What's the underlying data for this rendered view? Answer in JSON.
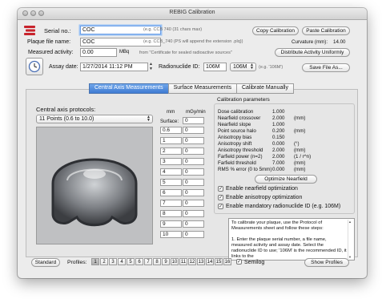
{
  "window": {
    "title": "REBIG Calibration"
  },
  "header": {
    "serial_label": "Serial no.:",
    "serial_value": "COC",
    "serial_hint": "(e.g. CCB 740 (31 chars max)",
    "copy_button": "Copy Calibration",
    "paste_button": "Paste Calibration",
    "plaque_label": "Plaque file name:",
    "plaque_value": "COC",
    "plaque_hint": "(e.g. CCB_740 (PS will append the extension .plq))",
    "curvature_label": "Curvature (mm):",
    "curvature_value": "14.00",
    "activity_label": "Measured activity:",
    "activity_value": "0.00",
    "activity_unit": "MBq",
    "activity_hint": "from \"Certificate for sealed radioactive sources\"",
    "distribute_button": "Distribute Activity Uniformly",
    "assay_label": "Assay date:",
    "assay_value": "1/27/2014 11:12 PM",
    "radionuclide_label": "Radionuclide ID:",
    "radionuclide_value": "106M",
    "radionuclide_select": "106M",
    "radionuclide_hint": "(e.g. '106M')",
    "save_button": "Save File As..."
  },
  "tabs": [
    {
      "label": "Central Axis Measurements",
      "selected": true
    },
    {
      "label": "Surface Measurements",
      "selected": false
    },
    {
      "label": "Calibrate Manually",
      "selected": false
    }
  ],
  "protocols": {
    "label": "Central axis protocols:",
    "selected": "11 Points (0.6 to 10.0)"
  },
  "measurements": {
    "col_mm": "mm",
    "col_rate": "mGy/min",
    "surface_label": "Surface:",
    "rows": [
      {
        "mm": "",
        "rate": "0"
      },
      {
        "mm": "0.6",
        "rate": "0"
      },
      {
        "mm": "1",
        "rate": "0"
      },
      {
        "mm": "2",
        "rate": "0"
      },
      {
        "mm": "3",
        "rate": "0"
      },
      {
        "mm": "4",
        "rate": "0"
      },
      {
        "mm": "5",
        "rate": "0"
      },
      {
        "mm": "6",
        "rate": "0"
      },
      {
        "mm": "7",
        "rate": "0"
      },
      {
        "mm": "8",
        "rate": "0"
      },
      {
        "mm": "9",
        "rate": "0"
      },
      {
        "mm": "10",
        "rate": "0"
      }
    ]
  },
  "calibration": {
    "title": "Calibration parameters",
    "params": [
      {
        "name": "Dose calibration",
        "value": "1.000",
        "unit": ""
      },
      {
        "name": "Nearfield crossover",
        "value": "2.000",
        "unit": "(mm)"
      },
      {
        "name": "Nearfield slope",
        "value": "1.000",
        "unit": ""
      },
      {
        "name": "Point source halo",
        "value": "0.200",
        "unit": "(mm)"
      },
      {
        "name": "Anisotropy bias",
        "value": "0.150",
        "unit": ""
      },
      {
        "name": "Anisotropy shift",
        "value": "0.000",
        "unit": "(°)"
      },
      {
        "name": "Anisotropy threshold",
        "value": "2.000",
        "unit": "(mm)"
      },
      {
        "name": "Farfield power (n=2)",
        "value": "2.000",
        "unit": "(1 / r^n)"
      },
      {
        "name": "Farfield threshold",
        "value": "7.000",
        "unit": "(mm)"
      },
      {
        "name": "RMS % error (0 to 5mm)",
        "value": "0.000",
        "unit": "(mm)"
      }
    ],
    "optimize_button": "Optimize Nearfield",
    "checkboxes": [
      {
        "label": "Enable nearfield optimization",
        "checked": true
      },
      {
        "label": "Enable anisotropy optimization",
        "checked": true
      },
      {
        "label": "Enable mandatory radionuclide ID (e.g. 106M)",
        "checked": true
      }
    ],
    "instructions": "To calibrate your plaque, use the Protocol of Measurements sheet and follow these steps:\n\n1. Enter the plaque serial number, a file name, measured activity and assay date. Select the radionuclide ID to use; '106M' is the recommended ID, it links to the"
  },
  "footer": {
    "standard_button": "Standard",
    "profiles_label": "Profiles:",
    "profiles": [
      "1",
      "2",
      "3",
      "4",
      "5",
      "6",
      "7",
      "8",
      "9",
      "10",
      "11",
      "12",
      "13",
      "14",
      "15",
      "16"
    ],
    "semilog_label": "Semilog",
    "semilog_checked": true,
    "show_profiles_button": "Show Profiles"
  },
  "colors": {
    "accent": "#3f7bd3",
    "window_bg": "#ececec",
    "logo_red": "#c8232c"
  },
  "icons": {
    "logo": "plaque-logo-icon",
    "clock": "clock-icon"
  }
}
